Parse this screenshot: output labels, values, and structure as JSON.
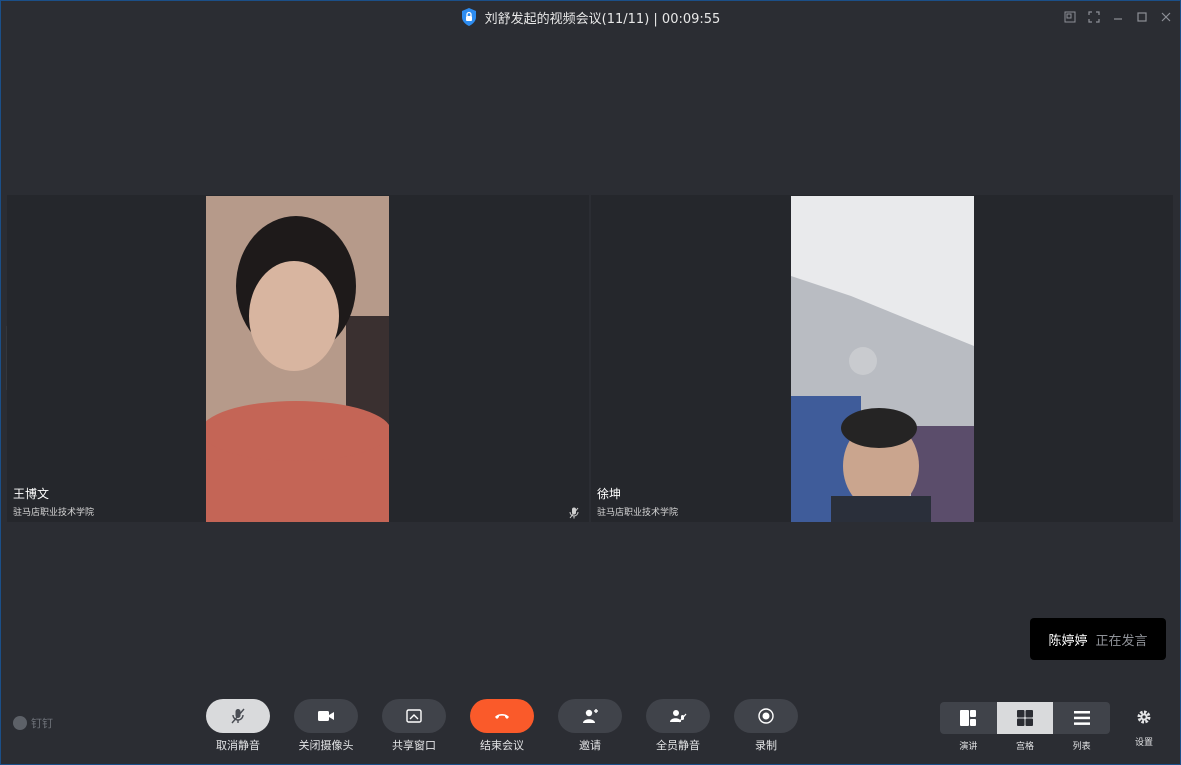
{
  "window": {
    "title": "刘舒发起的视频会议(11/11) | 00:09:55",
    "controls": [
      "popout-icon",
      "fullscreen-icon",
      "minimize-icon",
      "maximize-icon",
      "close-icon"
    ]
  },
  "participants": [
    {
      "name": "王博文",
      "org": "驻马店职业技术学院",
      "mic_icon": "mic-icon"
    },
    {
      "name": "徐坤",
      "org": "驻马店职业技术学院"
    }
  ],
  "speaker_toast": {
    "name": "陈婷婷",
    "status": "正在发言"
  },
  "brand": {
    "label": "钉钉"
  },
  "toolbar": {
    "unmute": "取消静音",
    "camera_off": "关闭摄像头",
    "share_window": "共享窗口",
    "end_meeting": "结束会议",
    "invite": "邀请",
    "mute_all": "全员静音",
    "record": "录制"
  },
  "layout": {
    "speaker": "演讲",
    "grid": "宫格",
    "list": "列表",
    "selected": "宫格"
  },
  "settings": {
    "label": "设置"
  },
  "colors": {
    "background": "#2b2d33",
    "tile": "#25272c",
    "end_call": "#fa5a2a",
    "accent_blue": "#2d8cf0"
  }
}
